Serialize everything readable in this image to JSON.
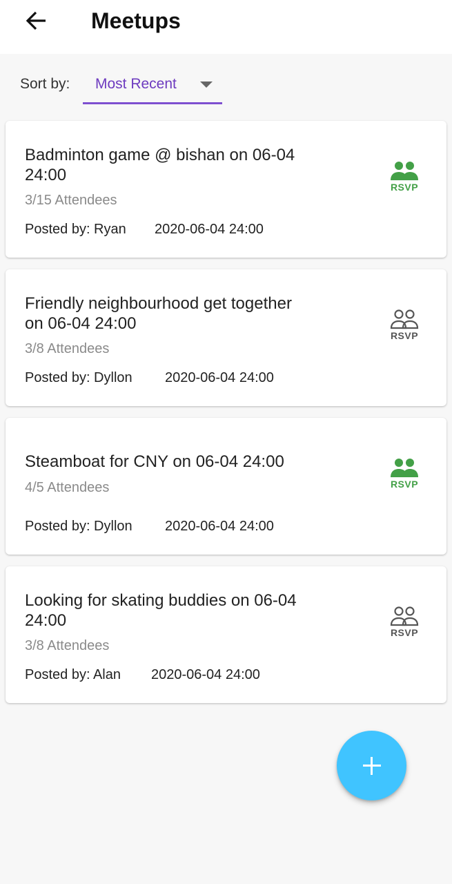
{
  "header": {
    "title": "Meetups",
    "back_icon": "arrow-left-icon"
  },
  "sort": {
    "label": "Sort by:",
    "selected": "Most Recent",
    "accent_color": "#7e4fd0"
  },
  "meetups": [
    {
      "title": "Badminton game @ bishan on 06-04 24:00",
      "attendees": "3/15 Attendees",
      "posted_by": "Posted by: Ryan",
      "date": "2020-06-04 24:00",
      "rsvp_label": "RSVP",
      "rsvp_state": "active",
      "rsvp_icon": "people-filled-icon"
    },
    {
      "title": "Friendly neighbourhood get together on 06-04 24:00",
      "attendees": "3/8 Attendees",
      "posted_by": "Posted by: Dyllon",
      "date": "2020-06-04 24:00",
      "rsvp_label": "RSVP",
      "rsvp_state": "inactive",
      "rsvp_icon": "people-outline-icon"
    },
    {
      "title": "Steamboat for CNY on 06-04 24:00",
      "attendees": "4/5 Attendees",
      "posted_by": "Posted by: Dyllon",
      "date": "2020-06-04 24:00",
      "rsvp_label": "RSVP",
      "rsvp_state": "active",
      "rsvp_icon": "people-filled-icon"
    },
    {
      "title": "Looking for skating buddies on 06-04 24:00",
      "attendees": "3/8 Attendees",
      "posted_by": "Posted by: Alan",
      "date": "2020-06-04 24:00",
      "rsvp_label": "RSVP",
      "rsvp_state": "inactive",
      "rsvp_icon": "people-outline-icon"
    }
  ],
  "fab": {
    "icon": "plus-icon",
    "color": "#40c4ff"
  },
  "colors": {
    "rsvp_active": "#43a047",
    "rsvp_inactive": "#555555"
  }
}
